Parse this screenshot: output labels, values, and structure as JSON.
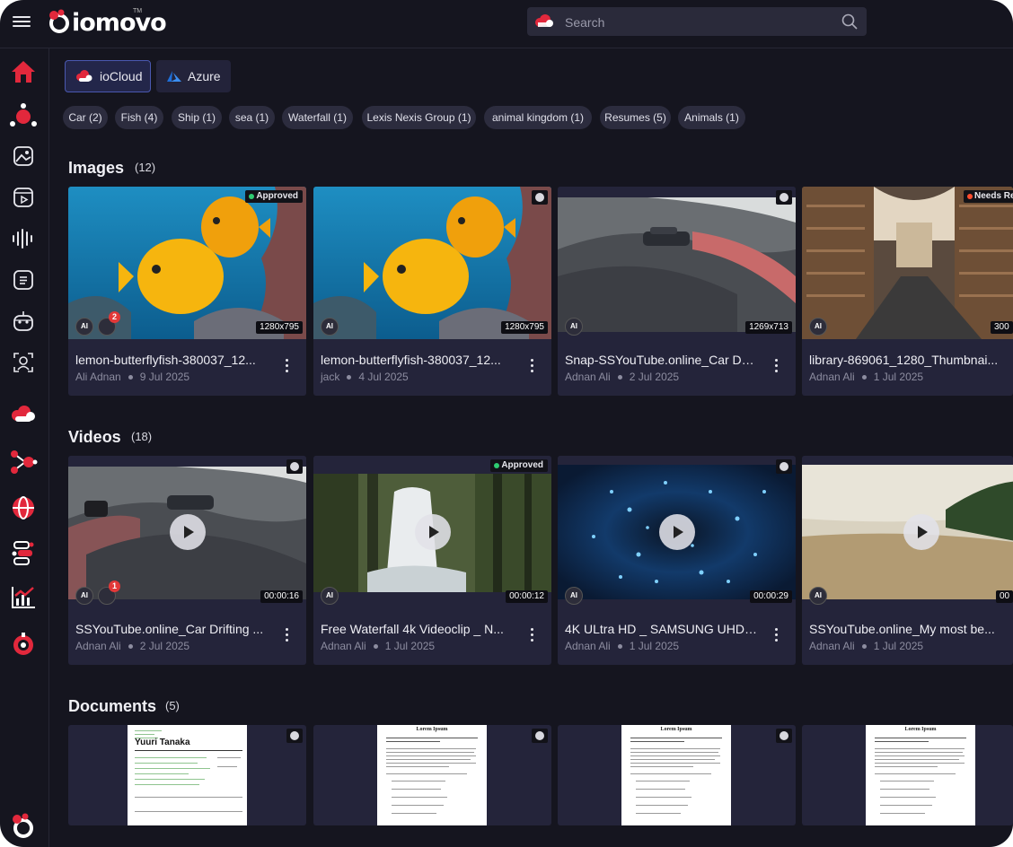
{
  "app": {
    "logo_text": "iomovo",
    "tm": "TM"
  },
  "search": {
    "placeholder": "Search"
  },
  "sources": [
    {
      "label": "ioCloud",
      "icon": "cloud-icon",
      "active": true
    },
    {
      "label": "Azure",
      "icon": "azure-icon",
      "active": false
    }
  ],
  "tags": [
    "Car (2)",
    "Fish (4)",
    "Ship (1)",
    "sea (1)",
    "Waterfall (1)",
    "Lexis Nexis Group (1)",
    "animal kingdom (1)",
    "Resumes (5)",
    "Animals (1)"
  ],
  "images": {
    "title": "Images",
    "count": "(12)",
    "items": [
      {
        "title": "lemon-butterflyfish-380037_12...",
        "author": "Ali Adnan",
        "date": "9 Jul 2025",
        "status": "Approved",
        "status_color": "#2ecc71",
        "resolution": "1280x795",
        "ai": "AI",
        "comments": "2"
      },
      {
        "title": "lemon-butterflyfish-380037_12...",
        "author": "jack",
        "date": "4 Jul 2025",
        "resolution": "1280x795",
        "ai": "AI"
      },
      {
        "title": "Snap-SSYouTube.online_Car Dri...",
        "author": "Adnan Ali",
        "date": "2 Jul 2025",
        "resolution": "1269x713",
        "ai": "AI"
      },
      {
        "title": "library-869061_1280_Thumbnai...",
        "author": "Adnan Ali",
        "date": "1 Jul 2025",
        "status": "Needs Re",
        "status_color": "#ff4d2e",
        "resolution": "300",
        "ai": "AI"
      }
    ]
  },
  "videos": {
    "title": "Videos",
    "count": "(18)",
    "items": [
      {
        "title": "SSYouTube.online_Car Drifting ...",
        "author": "Adnan Ali",
        "date": "2 Jul 2025",
        "duration": "00:00:16",
        "ai": "AI",
        "comments": "1"
      },
      {
        "title": "Free Waterfall 4k Videoclip _ N...",
        "author": "Adnan Ali",
        "date": "1 Jul 2025",
        "status": "Approved",
        "status_color": "#2ecc71",
        "duration": "00:00:12",
        "ai": "AI"
      },
      {
        "title": "4K ULtra HD _ SAMSUNG UHD ...",
        "author": "Adnan Ali",
        "date": "1 Jul 2025",
        "duration": "00:00:29",
        "ai": "AI"
      },
      {
        "title": "SSYouTube.online_My most be...",
        "author": "Adnan Ali",
        "date": "1 Jul 2025",
        "duration": "00",
        "ai": "AI"
      }
    ]
  },
  "documents": {
    "title": "Documents",
    "count": "(5)",
    "items": [
      {
        "heading": "",
        "name": "Yuuri Tanaka"
      },
      {
        "heading": "Lorem Ipsum",
        "name": ""
      },
      {
        "heading": "Lorem Ipsum",
        "name": ""
      },
      {
        "heading": "Lorem Ipsum",
        "name": ""
      }
    ]
  },
  "sidebar": [
    "home-icon",
    "asset-hub-icon",
    "image-icon",
    "video-icon",
    "audio-icon",
    "document-icon",
    "ai-bot-icon",
    "face-icon",
    "cloud-icon",
    "workflow-icon",
    "globe-icon",
    "integration-icon",
    "analytics-icon",
    "settings-icon"
  ],
  "colors": {
    "background": "#15151f",
    "card": "#24243a",
    "accent": "#e2283c",
    "active_border": "#4a58b0"
  }
}
